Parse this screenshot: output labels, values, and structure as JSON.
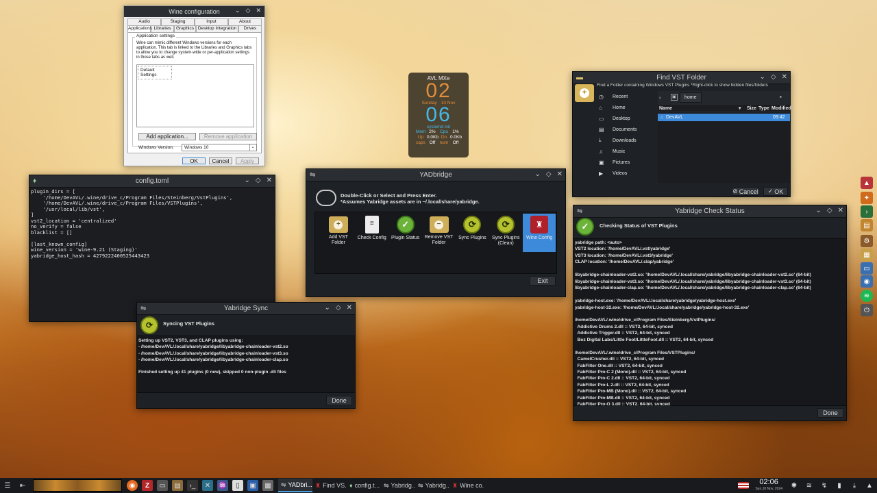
{
  "wine": {
    "title": "Wine configuration",
    "tabs_row1": [
      "Audio",
      "Staging",
      "Input",
      "About"
    ],
    "tabs_row2": [
      "Applications",
      "Libraries",
      "Graphics",
      "Desktop Integration",
      "Drives"
    ],
    "group_label": "Application settings",
    "description": "Wine can mimic different Windows versions for each application. This tab is linked to the Libraries and Graphics tabs to allow you to change system-wide or per-application settings in those tabs as well.",
    "list_item": "Default Settings",
    "add_app": "Add application...",
    "remove_app": "Remove application",
    "version_label": "Windows Version:",
    "version_value": "Windows 10",
    "ok": "OK",
    "cancel": "Cancel",
    "apply": "Apply"
  },
  "config": {
    "title": "config.toml",
    "lines": [
      "plugin_dirs = [",
      "    '/home/DevAVL/.wine/drive_c/Program Files/Steinberg/VstPlugins',",
      "    '/home/DevAVL/.wine/drive_c/Program Files/VSTPlugins',",
      "    '/usr/local/lib/vst',",
      "]",
      "vst2_location = 'centralized'",
      "no_verify = false",
      "blacklist = []",
      "",
      "[last_known_config]",
      "wine_version = 'wine-9.21 (Staging)'",
      "yabridge_host_hash = 4279222400525443423"
    ]
  },
  "clock_widget": {
    "title": "AVL MXe",
    "hour": "02",
    "day": "Sunday",
    "date": "10 Nov",
    "minute": "06",
    "service": "systemd init",
    "mem_label": "Mem",
    "mem_val": "2%",
    "cpu_label": "Cpu",
    "cpu_val": "1%",
    "up_label": "Up",
    "up_val": "0.0Kb",
    "dn_label": "Dn",
    "dn_val": "0.0Kb",
    "caps_label": "caps",
    "caps_val": "Off",
    "num_label": "num",
    "num_val": "Off"
  },
  "yadbridge": {
    "title": "YADbridge",
    "instr1": "Double-Click or Select and Press Enter.",
    "instr2": "*Assumes Yabridge assets are in ~/.local/share/yabridge.",
    "items": [
      {
        "label": "Add VST Folder",
        "icon": "folder-add-icon"
      },
      {
        "label": "Check Config",
        "icon": "clipboard-icon"
      },
      {
        "label": "Plugin Status",
        "icon": "check-icon"
      },
      {
        "label": "Remove VST Folder",
        "icon": "folder-remove-icon"
      },
      {
        "label": "Sync Plugins",
        "icon": "sync-icon"
      },
      {
        "label": "Sync Plugins (Clean)",
        "icon": "sync-icon"
      },
      {
        "label": "Wine Config",
        "icon": "wine-icon"
      }
    ],
    "exit": "Exit"
  },
  "sync": {
    "title": "Yabridge Sync",
    "header": "Syncing VST Plugins",
    "lines": [
      "Setting up VST2, VST3, and CLAP plugins using:",
      "- /home/DevAVL/.local/share/yabridge/libyabridge-chainloader-vst2.so",
      "- /home/DevAVL/.local/share/yabridge/libyabridge-chainloader-vst3.so",
      "- /home/DevAVL/.local/share/yabridge/libyabridge-chainloader-clap.so",
      "",
      "Finished setting up 41 plugins (0 new), skipped 0 non-plugin .dll files"
    ],
    "done": "Done"
  },
  "finder": {
    "title": "Find VST Folder",
    "subtitle": "Find a Folder containing Windows VST Plugins *Right-click to show hidden files/folders",
    "places": [
      {
        "label": "Recent",
        "icon": "clock-icon"
      },
      {
        "label": "Home",
        "icon": "home-icon"
      },
      {
        "label": "Desktop",
        "icon": "desktop-icon"
      },
      {
        "label": "Documents",
        "icon": "documents-icon"
      },
      {
        "label": "Downloads",
        "icon": "downloads-icon"
      },
      {
        "label": "Music",
        "icon": "music-icon"
      },
      {
        "label": "Pictures",
        "icon": "pictures-icon"
      },
      {
        "label": "Videos",
        "icon": "videos-icon"
      }
    ],
    "path": "home",
    "col_name": "Name",
    "col_size": "Size",
    "col_type": "Type",
    "col_modified": "Modified",
    "row_name": "DevAVL",
    "row_modified": "09:42",
    "cancel": "Cancel",
    "ok": "OK"
  },
  "status": {
    "title": "Yabridge Check Status",
    "header": "Checking Status of VST Plugins",
    "lines": [
      "yabridge path: <auto>",
      "VST2 location: '/home/DevAVL/.vst/yabridge'",
      "VST3 location: '/home/DevAVL/.vst3/yabridge'",
      "CLAP location: '/home/DevAVL/.clap/yabridge'",
      "",
      "libyabridge-chainloader-vst2.so: '/home/DevAVL/.local/share/yabridge/libyabridge-chainloader-vst2.so' (64-bit)",
      "libyabridge-chainloader-vst3.so: '/home/DevAVL/.local/share/yabridge/libyabridge-chainloader-vst3.so' (64-bit)",
      "libyabridge-chainloader-clap.so: '/home/DevAVL/.local/share/yabridge/libyabridge-chainloader-clap.so' (64-bit)",
      "",
      "yabridge-host.exe: '/home/DevAVL/.local/share/yabridge/yabridge-host.exe'",
      "yabridge-host-32.exe: '/home/DevAVL/.local/share/yabridge/yabridge-host-32.exe'",
      "",
      "/home/DevAVL/.wine/drive_c/Program Files/Steinberg/VstPlugins/",
      "  Addictive Drums 2.dll :: VST2, 64-bit, synced",
      "  Addictive Trigger.dll :: VST2, 64-bit, synced",
      "  Boz Digital Labs/Little Foot/LittleFoot.dll :: VST2, 64-bit, synced",
      "",
      "/home/DevAVL/.wine/drive_c/Program Files/VSTPlugins/",
      "  CamelCrusher.dll :: VST2, 64-bit, synced",
      "  FabFilter One.dll :: VST2, 64-bit, synced",
      "  FabFilter Pro-C 2 (Mono).dll :: VST2, 64-bit, synced",
      "  FabFilter Pro-C 2.dll :: VST2, 64-bit, synced",
      "  FabFilter Pro-L 2.dll :: VST2, 64-bit, synced",
      "  FabFilter Pro-MB (Mono).dll :: VST2, 64-bit, synced",
      "  FabFilter Pro-MB.dll :: VST2, 64-bit, synced",
      "  FabFilter Pro-Q 3.dll :: VST2, 64-bit, synced"
    ],
    "done": "Done"
  },
  "taskbar": {
    "tasks": [
      {
        "label": "YADbri...",
        "icon": "yad-icon",
        "active": true
      },
      {
        "label": "Find VS...",
        "icon": "wine-icon",
        "active": false
      },
      {
        "label": "config.t...",
        "icon": "text-icon",
        "active": false
      },
      {
        "label": "Yabridg...",
        "icon": "yad-icon",
        "active": false
      },
      {
        "label": "Yabridg...",
        "icon": "yad-icon",
        "active": false
      },
      {
        "label": "Wine co...",
        "icon": "wine-icon",
        "active": false
      }
    ],
    "time": "02:06",
    "date": "Sun,10 Nov, 2024"
  },
  "colors": {
    "accent_blue": "#3c8ad9",
    "check_green": "#6cb33a",
    "sync_yellow": "#b6c22d",
    "widget_orange": "#e08d3c",
    "widget_blue": "#45b8e6"
  }
}
